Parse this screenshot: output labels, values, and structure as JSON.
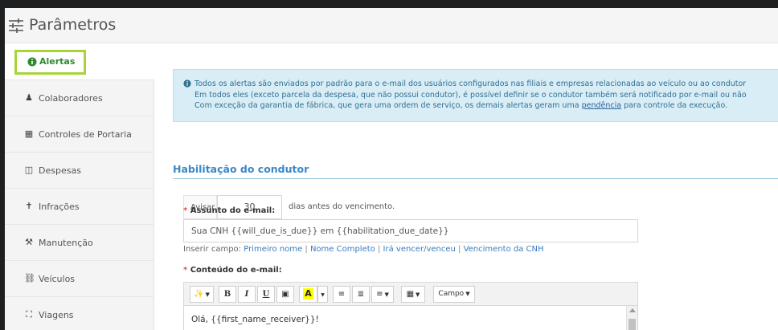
{
  "header": {
    "title": "Parâmetros",
    "icon": "sliders-icon"
  },
  "sidebar": {
    "items": [
      {
        "label": "Alertas",
        "icon": "info-circle-icon",
        "active": true
      },
      {
        "label": "Colaboradores",
        "icon": "user-tie-icon"
      },
      {
        "label": "Controles de Portaria",
        "icon": "gate-icon"
      },
      {
        "label": "Despesas",
        "icon": "money-icon"
      },
      {
        "label": "Infrações",
        "icon": "traffic-light-icon"
      },
      {
        "label": "Manutenção",
        "icon": "tools-icon"
      },
      {
        "label": "Veículos",
        "icon": "car-icon"
      },
      {
        "label": "Viagens",
        "icon": "road-icon"
      }
    ]
  },
  "info_alert": {
    "line1": "Todos os alertas são enviados por padrão para o e-mail dos usuários configurados nas filiais e empresas relacionadas ao veículo ou ao condutor",
    "line2": "Em todos eles (exceto parcela da despesa, que não possui condutor), é possível definir se o condutor também será notificado por e-mail ou não",
    "line3_before": "Com exceção da garantia de fábrica, que gera uma ordem de serviço, os demais alertas geram uma",
    "line3_link": "pendência",
    "line3_after": "para controle da execução."
  },
  "section": {
    "title": "Habilitação do condutor",
    "avisar_label": "Avisar",
    "avisar_value": "30",
    "avisar_suffix": "dias antes do vencimento.",
    "subject_label": "Assunto do e-mail:",
    "required_mark": "*",
    "subject_value": "Sua CNH {{will_due_is_due}} em {{habilitation_due_date}}",
    "insert_prefix": "Inserir campo:",
    "insert_fields": [
      "Primeiro nome",
      "Nome Completo",
      "Irá vencer/venceu",
      "Vencimento da CNH"
    ],
    "insert_separator": "|",
    "content_label": "Conteúdo do e-mail:",
    "editor_text": "Olá, {{first_name_receiver}}!"
  },
  "toolbar": {
    "bold": "B",
    "italic": "I",
    "underline": "U",
    "highlight": "A",
    "campo": "Campo"
  },
  "colors": {
    "accent_green": "#2e8b2e",
    "highlight_border": "#a6d43a",
    "section_blue": "#3a87c8",
    "alert_bg": "#d9edf7"
  }
}
